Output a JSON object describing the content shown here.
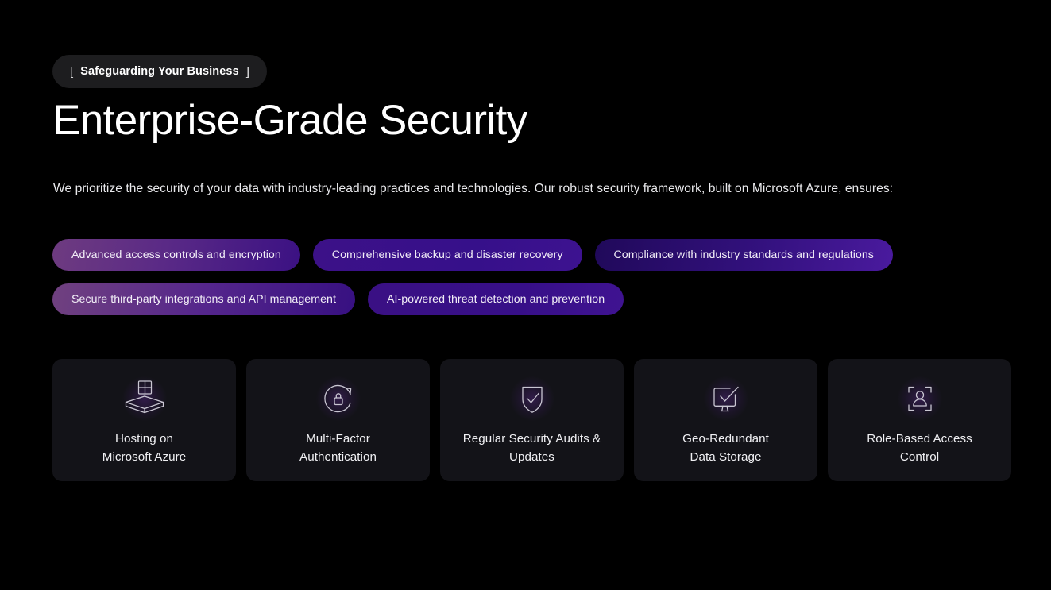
{
  "badge": {
    "bracket_open": "[",
    "text": "Safeguarding Your Business",
    "bracket_close": "]"
  },
  "heading": "Enterprise-Grade Security",
  "subtitle": "We prioritize the security of your data with industry-leading practices and technologies. Our robust security framework, built on Microsoft Azure, ensures:",
  "pills": [
    {
      "label": "Advanced access controls and encryption"
    },
    {
      "label": "Comprehensive backup and disaster recovery"
    },
    {
      "label": "Compliance with industry standards and regulations"
    },
    {
      "label": "Secure third-party integrations and API management"
    },
    {
      "label": "AI-powered threat detection and prevention"
    }
  ],
  "cards": [
    {
      "icon": "windows-azure-platform-icon",
      "line1": "Hosting on",
      "line2": "Microsoft Azure"
    },
    {
      "icon": "lock-refresh-icon",
      "line1": "Multi-Factor",
      "line2": "Authentication"
    },
    {
      "icon": "shield-check-icon",
      "line1": "Regular Security Audits &",
      "line2": "Updates"
    },
    {
      "icon": "monitor-check-icon",
      "line1": "Geo-Redundant",
      "line2": "Data Storage"
    },
    {
      "icon": "person-scan-frame-icon",
      "line1": "Role-Based Access",
      "line2": "Control"
    }
  ],
  "colors": {
    "page_background": "#000000",
    "badge_background": "#1d1d1f",
    "card_background": "#131318",
    "pill_accent_mauve": "#6e3b80",
    "pill_accent_indigo": "#3b1183",
    "pill_accent_violet": "#4a1a9e",
    "text_primary": "#ffffff",
    "icon_stroke": "#c9c6d2"
  }
}
